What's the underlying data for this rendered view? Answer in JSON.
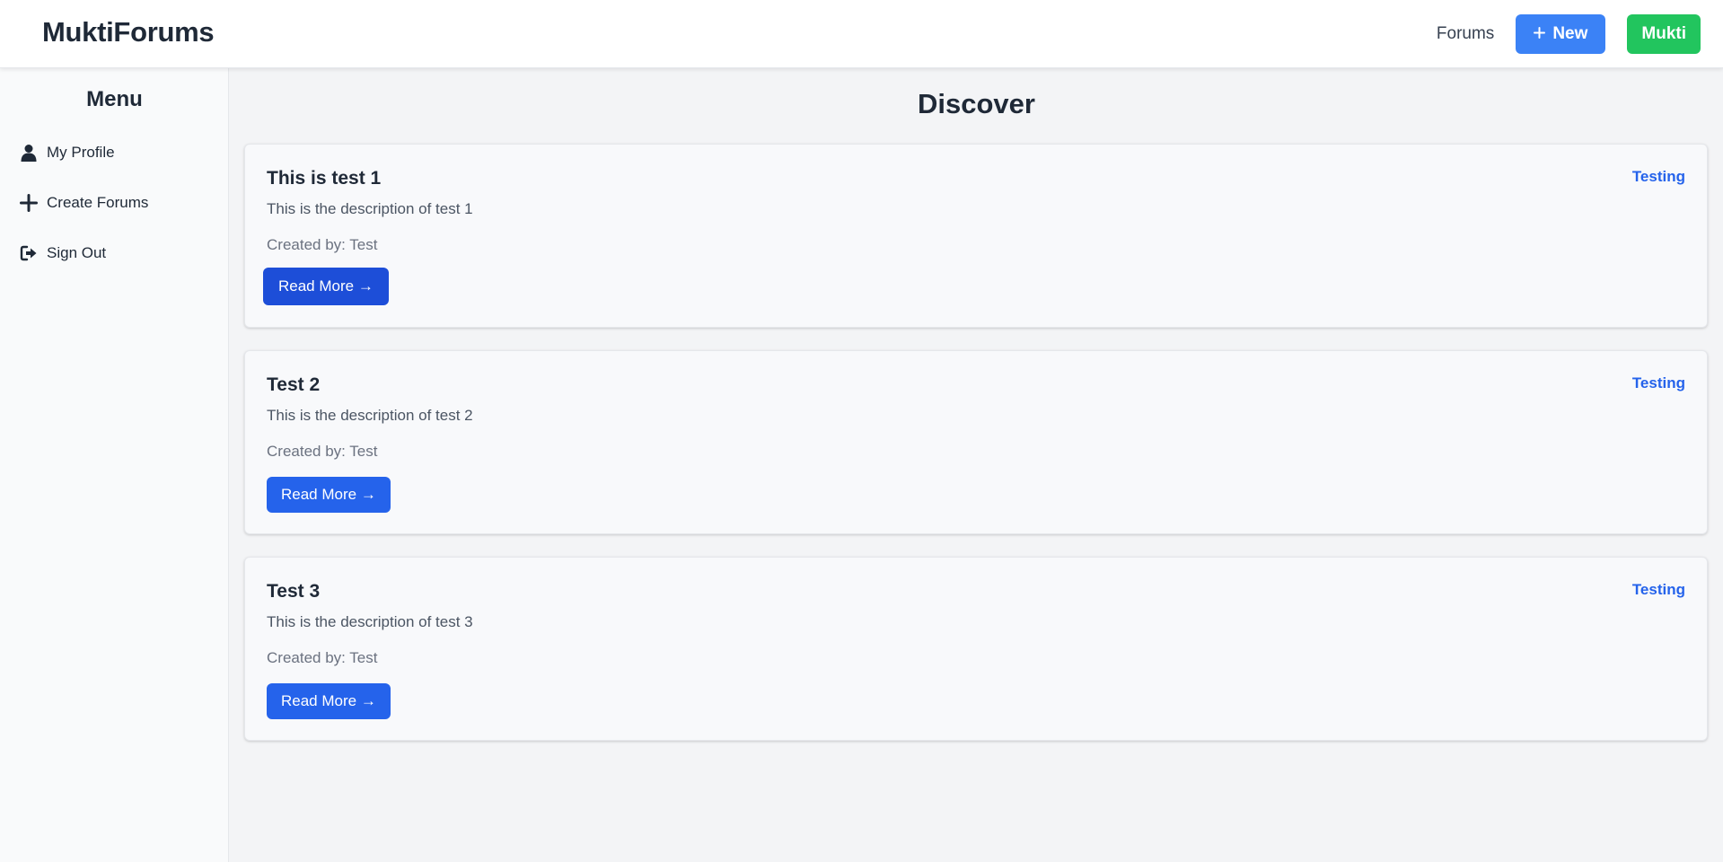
{
  "header": {
    "brand": "MuktiForums",
    "nav_forums": "Forums",
    "new_button": "New",
    "new_icon": "plus-icon",
    "user_button": "Mukti"
  },
  "sidebar": {
    "title": "Menu",
    "items": [
      {
        "label": "My Profile",
        "icon": "user-icon"
      },
      {
        "label": "Create Forums",
        "icon": "plus-icon"
      },
      {
        "label": "Sign Out",
        "icon": "sign-out-icon"
      }
    ]
  },
  "main": {
    "title": "Discover",
    "cards": [
      {
        "title": "This is test 1",
        "tag": "Testing",
        "description": "This is the description of test 1",
        "created_by": "Created by: Test",
        "button": "Read More →"
      },
      {
        "title": "Test 2",
        "tag": "Testing",
        "description": "This is the description of test 2",
        "created_by": "Created by: Test",
        "button": "Read More →"
      },
      {
        "title": "Test 3",
        "tag": "Testing",
        "description": "This is the description of test 3",
        "created_by": "Created by: Test",
        "button": "Read More →"
      }
    ]
  },
  "colors": {
    "primary": "#2563eb",
    "primary_hover": "#1d4ed8",
    "new_button": "#3b82f6",
    "user_button": "#22c55e",
    "text": "#1f2937"
  }
}
